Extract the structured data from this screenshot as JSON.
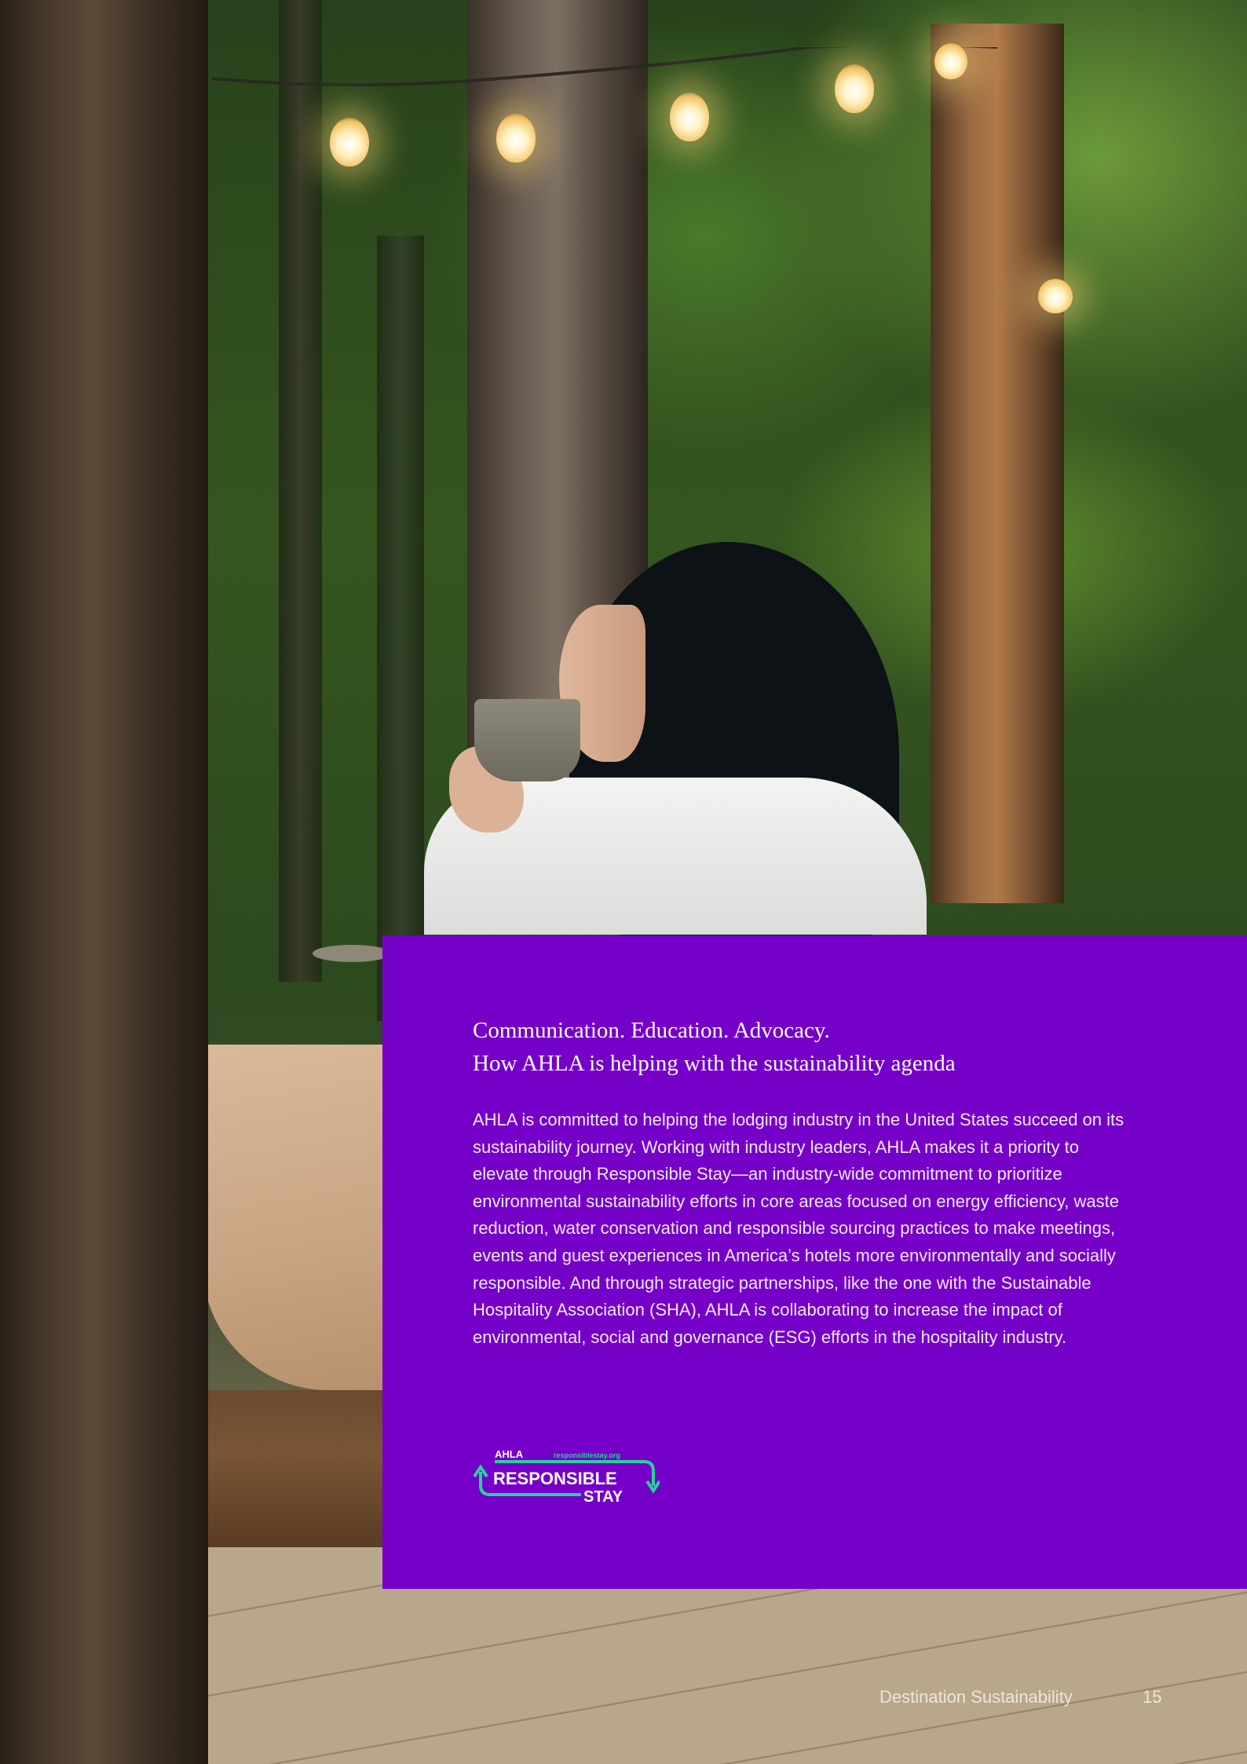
{
  "panel": {
    "heading_line1": "Communication. Education. Advocacy.",
    "heading_line2": "How AHLA is helping with the sustainability agenda",
    "body": "AHLA is committed to helping the lodging industry in the United States succeed on its sustainability journey. Working with industry leaders, AHLA makes it a priority to elevate through Responsible Stay—an industry-wide commitment to prioritize environmental sustainability efforts in core areas focused on energy efficiency, waste reduction, water conservation and responsible sourcing practices to make meetings, events and guest experiences in America’s hotels more environmentally and socially responsible. And through strategic partnerships, like the one with the Sustainable Hospitality Association (SHA), AHLA is collaborating to increase the impact of environmental, social and governance (ESG) efforts in the hospitality industry.",
    "accent_color": "#7500c8"
  },
  "logo": {
    "org": "AHLA",
    "url": "responsiblestay.org",
    "line1": "RESPONSIBLE",
    "line2": "STAY",
    "accent": "#23d49a"
  },
  "footer": {
    "title": "Destination Sustainability",
    "page_number": "15"
  }
}
